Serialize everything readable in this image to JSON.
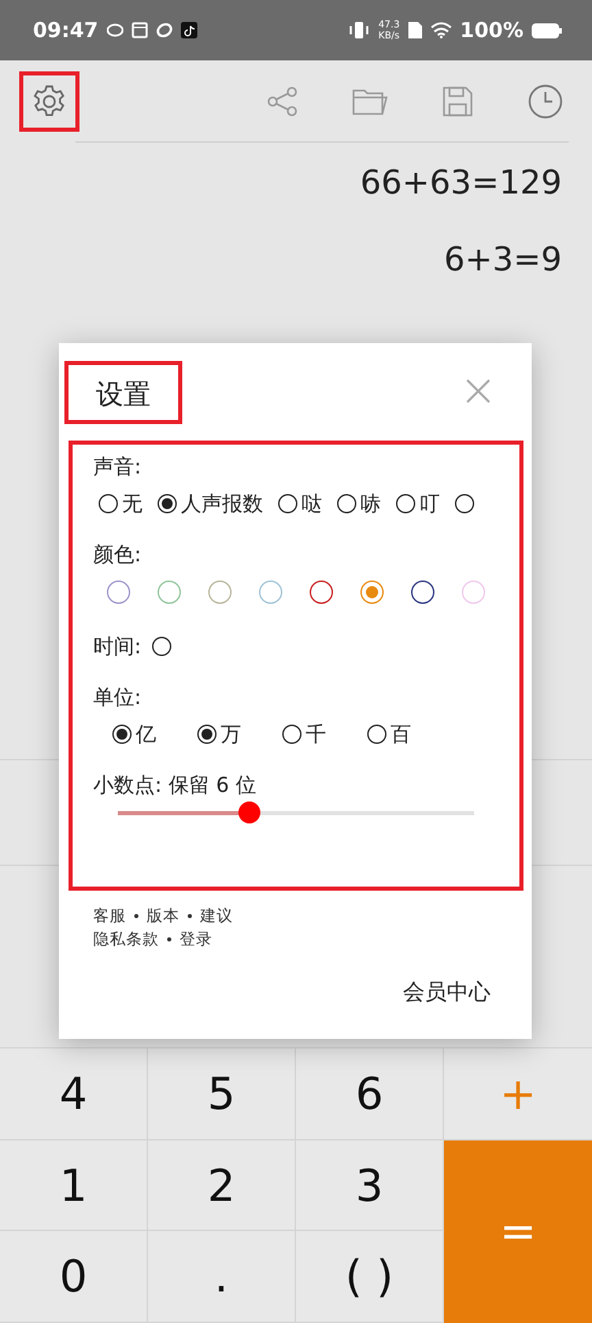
{
  "status_bar": {
    "time": "09:47",
    "net_speed": "47.3",
    "net_unit": "KB/s",
    "battery": "100%"
  },
  "toolbar": {
    "settings": {
      "highlighted": true
    }
  },
  "history": [
    "66+63=129",
    "6+3=9"
  ],
  "keypad": [
    {
      "label": "4",
      "kind": "digit"
    },
    {
      "label": "5",
      "kind": "digit"
    },
    {
      "label": "6",
      "kind": "digit"
    },
    {
      "label": "+",
      "kind": "operator"
    },
    {
      "label": "1",
      "kind": "digit"
    },
    {
      "label": "2",
      "kind": "digit"
    },
    {
      "label": "3",
      "kind": "digit"
    },
    {
      "label": "=",
      "kind": "equals"
    },
    {
      "label": "0",
      "kind": "digit"
    },
    {
      "label": ".",
      "kind": "digit"
    },
    {
      "label": "( )",
      "kind": "digit"
    }
  ],
  "dialog": {
    "title": "设置",
    "title_highlighted": true,
    "panel_highlighted": true,
    "sound": {
      "label": "声音:",
      "options": [
        {
          "label": "无",
          "selected": false
        },
        {
          "label": "人声报数",
          "selected": true
        },
        {
          "label": "哒",
          "selected": false
        },
        {
          "label": "哧",
          "selected": false
        },
        {
          "label": "叮",
          "selected": false
        },
        {
          "selected": false
        }
      ]
    },
    "colors": {
      "label": "颜色:",
      "options": [
        {
          "color": "#9c94cc",
          "selected": false
        },
        {
          "color": "#8fc49a",
          "selected": false
        },
        {
          "color": "#b7b59a",
          "selected": false
        },
        {
          "color": "#9fc3d6",
          "selected": false
        },
        {
          "color": "#c81e1e",
          "selected": false
        },
        {
          "color": "#e88a10",
          "selected": true
        },
        {
          "color": "#2a3580",
          "selected": false
        },
        {
          "color": "#f0c8ec",
          "selected": false
        }
      ]
    },
    "time": {
      "label": "时间:",
      "on": false
    },
    "units": {
      "label": "单位:",
      "options": [
        {
          "label": "亿",
          "checked": true
        },
        {
          "label": "万",
          "checked": true
        },
        {
          "label": "千",
          "checked": false
        },
        {
          "label": "百",
          "checked": false
        }
      ]
    },
    "decimal": {
      "label": "小数点: 保留 6 位",
      "level": 0.37
    },
    "links": [
      [
        "客服",
        "版本",
        "建议"
      ],
      [
        "隐私条款",
        "登录"
      ]
    ],
    "member_button": "会员中心"
  }
}
